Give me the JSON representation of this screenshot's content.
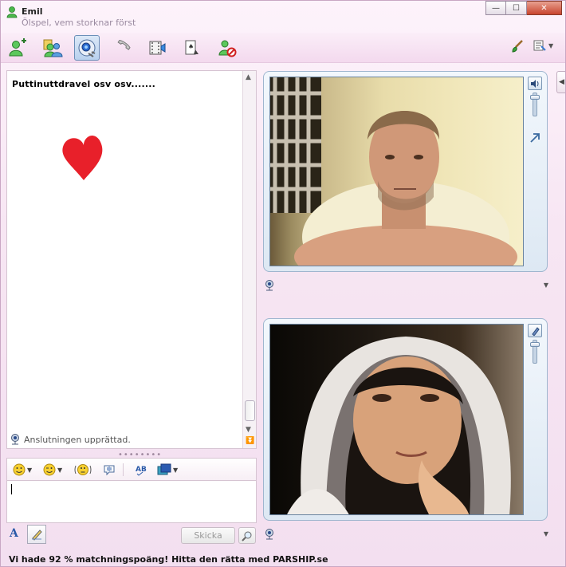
{
  "window": {
    "contact_name": "Emil",
    "contact_status": "Ölspel, vem storknar först",
    "controls": {
      "minimize": "—",
      "maximize": "☐",
      "close": "✕"
    }
  },
  "toolbar": {
    "icons": [
      "invite-contact-icon",
      "share-contacts-icon",
      "webcam-call-icon",
      "phone-call-icon",
      "video-clip-icon",
      "games-icon",
      "block-contact-icon"
    ],
    "right_icons": [
      "paintbrush-icon",
      "menu-icon"
    ]
  },
  "history": {
    "message": "Puttinuttdravel osv osv.......",
    "status": "Anslutningen upprättad.",
    "heart_color": "#e8202a"
  },
  "compose": {
    "splitter": "••••••••",
    "text": "",
    "send_label": "Skicka",
    "format_icons": [
      "emoticon-icon",
      "wink-icon",
      "nudge-icon",
      "voice-clip-icon",
      "spell-check-icon",
      "background-icon"
    ]
  },
  "ad": {
    "text": "Vi hade 92 % matchningspoäng! Hitta den rätta med PARSHIP.se"
  },
  "colors": {
    "window_bg": "#f7e6f3",
    "video_frame": "#dde8f3",
    "accent_blue": "#2a5aa8"
  }
}
